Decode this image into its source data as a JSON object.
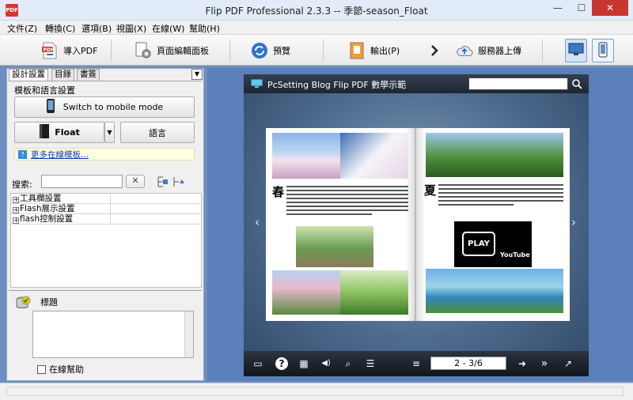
{
  "window": {
    "title": "Flip PDF Professional 2.3.3  -- 季節-season_Float",
    "min": "—",
    "max": "☐",
    "close": "✕",
    "app_icon_text": "PDF"
  },
  "menu": [
    "文件(Z)",
    "轉換(C)",
    "選項(B)",
    "視圖(X)",
    "在線(W)",
    "幫助(H)"
  ],
  "toolbar": {
    "import_pdf": "導入PDF",
    "page_editor": "頁面編輯面板",
    "preview": "預覽",
    "output": "輸出(P)",
    "upload": "服務器上傳",
    "pdf_badge": "PDF"
  },
  "left_panel": {
    "tabs": [
      "設計設置",
      "目錄",
      "書簽"
    ],
    "tab_arrow": "▼",
    "section_label": "模板和語言設置",
    "mobile_button": "Switch to mobile mode",
    "template_button": "Float",
    "template_arrow": "▼",
    "language_button": "語言",
    "more_templates": "更多在線模板...",
    "info_glyph": "?",
    "search_label": "搜索:",
    "search_value": "",
    "search_clear": "✕",
    "properties": [
      "工具欄設置",
      "Flash展示設置",
      "flash控制設置"
    ],
    "expander": "+",
    "help_title": "標題",
    "online_help": "在線幫助"
  },
  "viewer": {
    "title": "PcSetting Blog Flip PDF 數學示範",
    "left_big_char": "春",
    "right_big_char": "夏",
    "play_label": "PLAY",
    "youtube": "YouTube",
    "page_indicator": "2 - 3/6",
    "prev_arrow": "‹",
    "next_arrow": "›",
    "control_glyphs": {
      "fullscreen": "▭",
      "help": "?",
      "thumbnails": "▦",
      "sound": "◀)",
      "zoom": "⌕",
      "toc": "☰",
      "bookmark": "≡",
      "next_page": "➜",
      "last_page": "»",
      "share": "↗"
    }
  }
}
